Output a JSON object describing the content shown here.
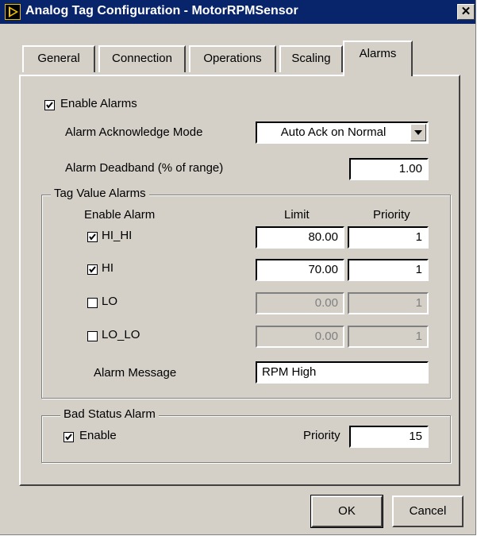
{
  "window": {
    "title": "Analog Tag Configuration - MotorRPMSensor",
    "close_label": "✕"
  },
  "tabs": [
    {
      "label": "General"
    },
    {
      "label": "Connection"
    },
    {
      "label": "Operations"
    },
    {
      "label": "Scaling"
    },
    {
      "label": "Alarms",
      "active": true
    }
  ],
  "alarms": {
    "enable_label": "Enable Alarms",
    "enable_checked": true,
    "ack_mode_label": "Alarm Acknowledge Mode",
    "ack_mode_value": "Auto Ack on Normal",
    "deadband_label": "Alarm Deadband (% of range)",
    "deadband_value": "1.00"
  },
  "tag_value_alarms": {
    "group_label": "Tag Value Alarms",
    "col_enable": "Enable Alarm",
    "col_limit": "Limit",
    "col_priority": "Priority",
    "rows": [
      {
        "name": "HI_HI",
        "checked": true,
        "limit": "80.00",
        "priority": "1",
        "enabled": true
      },
      {
        "name": "HI",
        "checked": true,
        "limit": "70.00",
        "priority": "1",
        "enabled": true
      },
      {
        "name": "LO",
        "checked": false,
        "limit": "0.00",
        "priority": "1",
        "enabled": false
      },
      {
        "name": "LO_LO",
        "checked": false,
        "limit": "0.00",
        "priority": "1",
        "enabled": false
      }
    ],
    "message_label": "Alarm Message",
    "message_value": "RPM High"
  },
  "bad_status": {
    "group_label": "Bad Status Alarm",
    "enable_label": "Enable",
    "enable_checked": true,
    "priority_label": "Priority",
    "priority_value": "15"
  },
  "buttons": {
    "ok": "OK",
    "cancel": "Cancel"
  },
  "colors": {
    "titlebar": "#08246b",
    "face": "#d4d0c8",
    "disabled_text": "#808080"
  },
  "icons": {
    "app": "labview-play-icon",
    "check": "check-mark-icon",
    "dropdown": "triangle-down-icon"
  }
}
